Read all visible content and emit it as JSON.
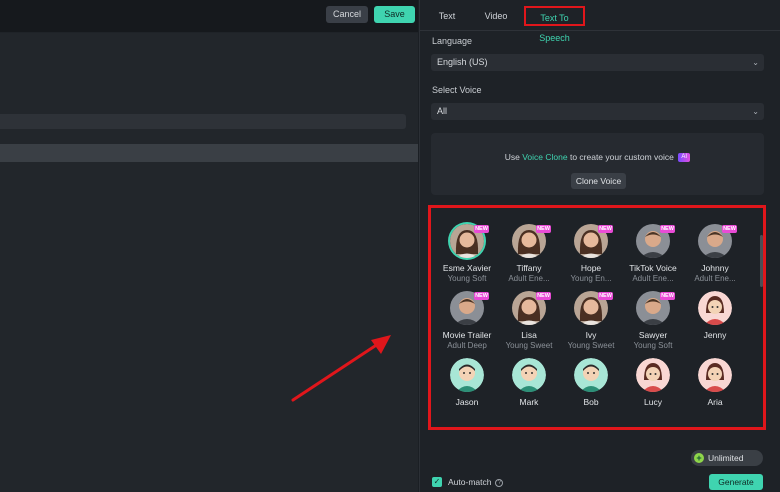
{
  "header": {
    "cancel_label": "Cancel",
    "save_label": "Save"
  },
  "tabs": [
    {
      "label": "Text",
      "active": false
    },
    {
      "label": "Video",
      "active": false
    },
    {
      "label": "Text To Speech",
      "active": true
    }
  ],
  "language": {
    "label": "Language",
    "value": "English (US)"
  },
  "voice_filter": {
    "label": "Select Voice",
    "value": "All"
  },
  "clone": {
    "prefix": "Use ",
    "link": "Voice Clone",
    "suffix": " to create your custom voice",
    "ai_badge": "AI",
    "button_label": "Clone Voice"
  },
  "voices": [
    {
      "name": "Esme Xavier",
      "desc": "Young Soft",
      "is_new": true,
      "selected": true,
      "avatar": "woman"
    },
    {
      "name": "Tiffany",
      "desc": "Adult Ene...",
      "is_new": true,
      "selected": false,
      "avatar": "woman"
    },
    {
      "name": "Hope",
      "desc": "Young En...",
      "is_new": true,
      "selected": false,
      "avatar": "woman"
    },
    {
      "name": "TikTok Voice",
      "desc": "Adult Ene...",
      "is_new": true,
      "selected": false,
      "avatar": "man"
    },
    {
      "name": "Johnny",
      "desc": "Adult Ene...",
      "is_new": true,
      "selected": false,
      "avatar": "man"
    },
    {
      "name": "Movie Trailer",
      "desc": "Adult Deep",
      "is_new": true,
      "selected": false,
      "avatar": "man"
    },
    {
      "name": "Lisa",
      "desc": "Young Sweet",
      "is_new": true,
      "selected": false,
      "avatar": "woman"
    },
    {
      "name": "Ivy",
      "desc": "Young Sweet",
      "is_new": true,
      "selected": false,
      "avatar": "woman"
    },
    {
      "name": "Sawyer",
      "desc": "Young Soft",
      "is_new": true,
      "selected": false,
      "avatar": "man"
    },
    {
      "name": "Jenny",
      "desc": "",
      "is_new": false,
      "selected": false,
      "avatar": "cartoon-girl"
    },
    {
      "name": "Jason",
      "desc": "",
      "is_new": false,
      "selected": false,
      "avatar": "cartoon-boy"
    },
    {
      "name": "Mark",
      "desc": "",
      "is_new": false,
      "selected": false,
      "avatar": "cartoon-boy"
    },
    {
      "name": "Bob",
      "desc": "",
      "is_new": false,
      "selected": false,
      "avatar": "cartoon-boy"
    },
    {
      "name": "Lucy",
      "desc": "",
      "is_new": false,
      "selected": false,
      "avatar": "cartoon-girl"
    },
    {
      "name": "Aria",
      "desc": "",
      "is_new": false,
      "selected": false,
      "avatar": "cartoon-girl"
    }
  ],
  "new_badge_label": "NEW",
  "unlimited": {
    "label": "Unlimited",
    "icon": "plus-icon"
  },
  "auto_match": {
    "label": "Auto-match",
    "checked": true
  },
  "generate_label": "Generate",
  "colors": {
    "accent": "#3fd4b0",
    "highlight": "#e0161b",
    "new_badge": "#e94bd6"
  }
}
